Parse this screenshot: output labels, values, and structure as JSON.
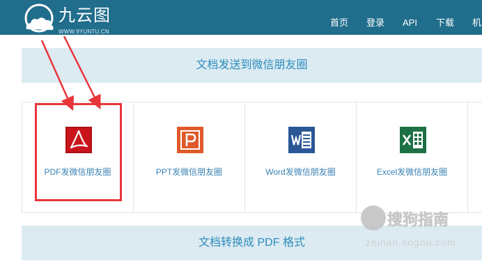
{
  "header": {
    "logo_name": "九云图",
    "logo_url": "WWW.9YUNTU.CN",
    "nav": [
      "首页",
      "登录",
      "API",
      "下载",
      "机"
    ]
  },
  "sections": {
    "share_title": "文档发送到微信朋友圈",
    "convert_title": "文档转换成 PDF 格式"
  },
  "cards": [
    {
      "label": "PDF发微信朋友圈",
      "icon": "pdf-icon",
      "color": "#c8141b"
    },
    {
      "label": "PPT发微信朋友圈",
      "icon": "powerpoint-icon",
      "color": "#e0592a"
    },
    {
      "label": "Word发微信朋友圈",
      "icon": "word-icon",
      "color": "#2b5797"
    },
    {
      "label": "Excel发微信朋友圈",
      "icon": "excel-icon",
      "color": "#1e7145"
    }
  ],
  "watermark": {
    "text": "搜狗指南",
    "url": "zhinan.sogou.com"
  },
  "colors": {
    "header_bg": "#206d8c",
    "section_bg": "#dcebf2",
    "section_text": "#2c8cbb",
    "highlight": "#e8353a"
  }
}
